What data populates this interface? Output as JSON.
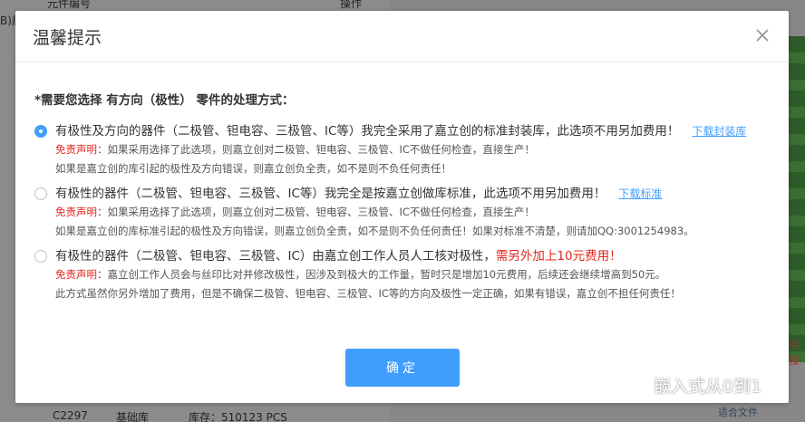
{
  "background": {
    "col_part_no": "元件编号",
    "col_action": "操作",
    "left_clip": "B)居",
    "row_code": "C2297",
    "row_lib": "基础库",
    "row_stock": "库存：510123 PCS",
    "right_link_clip": "适合文件",
    "right_red_clip": "引接"
  },
  "modal": {
    "title": "温馨提示",
    "question": "*需要您选择 有方向（极性） 零件的处理方式：",
    "options": [
      {
        "checked": true,
        "main": "有极性及方向的器件（二极管、钽电容、三极管、IC等）我完全采用了嘉立创的标准封装库，此选项不用另加费用！",
        "link": "下载封装库",
        "disclaimer_label": "免责声明",
        "line1": "：如果采用选择了此选项，则嘉立创对二极管、钽电容、三极管、IC不做任何检查，直接生产！",
        "line2": "如果是嘉立创的库引起的极性及方向错误，则嘉立创负全责，如不是则不负任何责任！"
      },
      {
        "checked": false,
        "main": "有极性的器件（二极管、钽电容、三极管、IC等）我完全是按嘉立创做库标准，此选项不用另加费用！",
        "link": "下载标准",
        "disclaimer_label": "免责声明",
        "line1": "：如果采用选择了此选项，则嘉立创对二极管、钽电容、三极管、IC不做任何检查，直接生产！",
        "line2": "如果是嘉立创的库标准引起的极性及方向错误，则嘉立创负全责，如不是则不负任何责任！如果对标准不清楚，则请加QQ:3001254983。"
      },
      {
        "checked": false,
        "main": "有极性的器件（二极管、钽电容、三极管、IC）由嘉立创工作人员人工核对极性，",
        "fee": "需另外加上10元费用！",
        "disclaimer_label": "免责声明",
        "line1": "：嘉立创工作人员会与丝印比对并修改极性，因涉及到极大的工作量，暂时只是增加10元费用，后续还会继续增高到50元。",
        "line2": "此方式虽然你另外增加了费用，但是不确保二极管、钽电容、三极管、IC等的方向及极性一定正确，如果有错误，嘉立创不担任何责任！"
      }
    ],
    "confirm_label": "确定"
  },
  "watermark": {
    "text": "嵌入式从0到1"
  },
  "colors": {
    "accent": "#409eff",
    "danger": "#e4251c"
  }
}
